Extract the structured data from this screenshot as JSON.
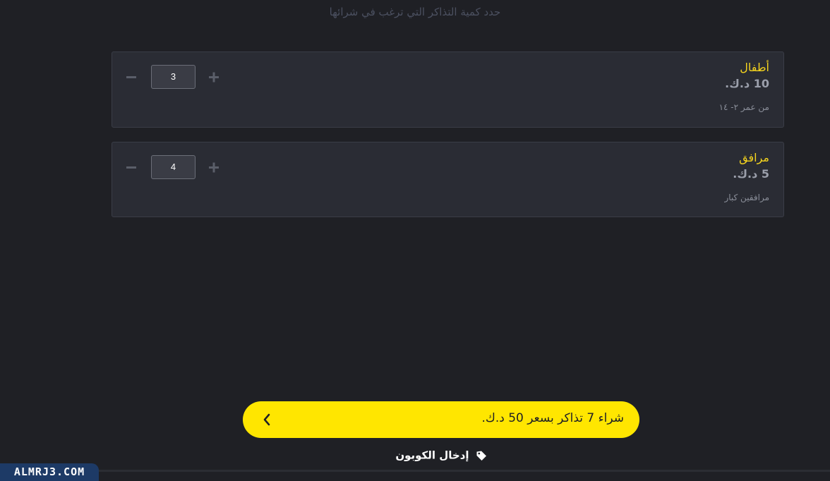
{
  "header": {
    "instruction": "حدد كمية التذاكر التي ترغب في شرائها"
  },
  "tickets": [
    {
      "name": "أطفال",
      "price": "10 د.ك.",
      "description": "من عمر ٢- ١٤",
      "quantity": "3"
    },
    {
      "name": "مرافق",
      "price": "5 د.ك.",
      "description": "مرافقين كبار",
      "quantity": "4"
    }
  ],
  "buy": {
    "label": "شراء 7 تذاكر بسعر 50 د.ك."
  },
  "coupon": {
    "label": "إدخال الكوبون"
  },
  "watermark": {
    "text": "ALMRJ3.COM"
  },
  "colors": {
    "background": "#1f2025",
    "card": "#2a2c34",
    "accent": "#ffe600",
    "name": "#f5d41e"
  },
  "icons": {
    "minus": "minus-icon",
    "plus": "plus-icon",
    "chevron": "chevron-left-icon",
    "coupon": "tag-icon"
  }
}
